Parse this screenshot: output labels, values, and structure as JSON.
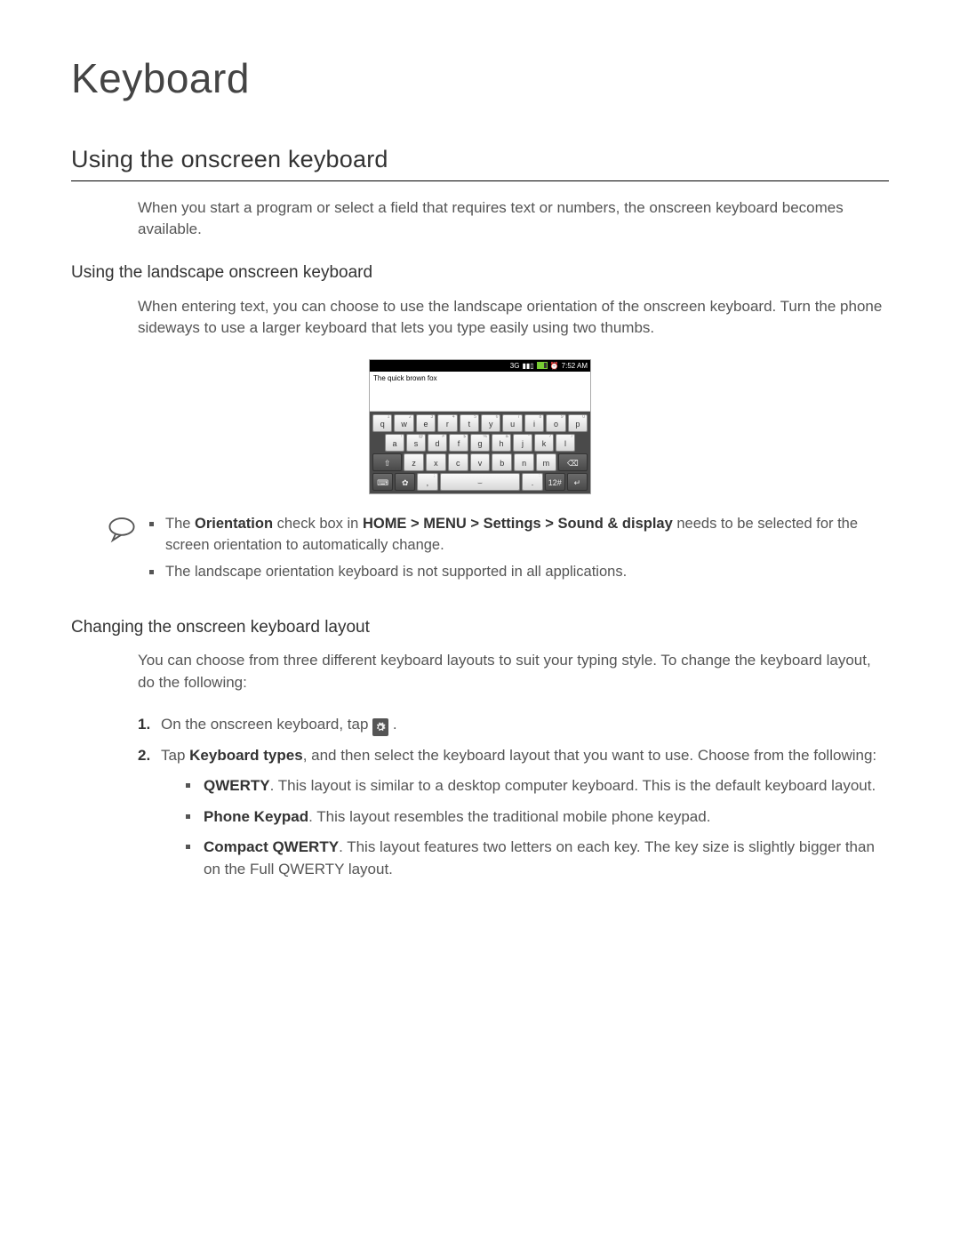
{
  "title": "Keyboard",
  "section": {
    "heading": "Using the onscreen keyboard",
    "intro": "When you start a program or select a field that requires text or numbers, the onscreen keyboard becomes available."
  },
  "sub1": {
    "heading": "Using the landscape onscreen keyboard",
    "text": "When entering text, you can choose to use the landscape orientation of the onscreen keyboard. Turn the phone sideways to use a larger keyboard that lets you type easily using two thumbs."
  },
  "phone": {
    "status_time": "7:52 AM",
    "input_text": "The quick brown fox",
    "row1": [
      {
        "k": "q",
        "s": "1"
      },
      {
        "k": "w",
        "s": "2"
      },
      {
        "k": "e",
        "s": "3"
      },
      {
        "k": "r",
        "s": "4"
      },
      {
        "k": "t",
        "s": "5"
      },
      {
        "k": "y",
        "s": "6"
      },
      {
        "k": "u",
        "s": "7"
      },
      {
        "k": "i",
        "s": "8"
      },
      {
        "k": "o",
        "s": "9"
      },
      {
        "k": "p",
        "s": "0"
      }
    ],
    "row2": [
      {
        "k": "a",
        "s": "!"
      },
      {
        "k": "s",
        "s": "@"
      },
      {
        "k": "d",
        "s": "#"
      },
      {
        "k": "f",
        "s": "$"
      },
      {
        "k": "g",
        "s": "%"
      },
      {
        "k": "h",
        "s": "&"
      },
      {
        "k": "j",
        "s": "*"
      },
      {
        "k": "k",
        "s": "?"
      },
      {
        "k": "l",
        "s": "/"
      }
    ],
    "row3_letters": [
      {
        "k": "z"
      },
      {
        "k": "x"
      },
      {
        "k": "c"
      },
      {
        "k": "v"
      },
      {
        "k": "b"
      },
      {
        "k": "n"
      },
      {
        "k": "m"
      }
    ],
    "row4": {
      "numkey": "12#"
    }
  },
  "notes": {
    "n1_pre": "The ",
    "n1_b": "Orientation",
    "n1_mid": " check box in ",
    "n1_path": "HOME > MENU > Settings > Sound & display",
    "n1_post": " needs to be selected for the screen orientation to automatically change.",
    "n2": "The landscape orientation keyboard is not supported in all applications."
  },
  "sub2": {
    "heading": "Changing the onscreen keyboard layout",
    "intro": "You can choose from three different keyboard layouts to suit your typing style. To change the keyboard layout, do the following:",
    "step1_pre": "On the onscreen keyboard, tap ",
    "step1_post": " .",
    "step2_pre": "Tap ",
    "step2_b": "Keyboard types",
    "step2_post": ", and then select the keyboard layout that you want to use. Choose from the following:",
    "opts": {
      "a_b": "QWERTY",
      "a_t": ". This layout is similar to a desktop computer keyboard. This is the default keyboard layout.",
      "b_b": "Phone Keypad",
      "b_t": ". This layout resembles the traditional mobile phone keypad.",
      "c_b": "Compact QWERTY",
      "c_t": ". This layout features two letters on each key. The key size is slightly bigger than on the Full QWERTY layout."
    }
  }
}
